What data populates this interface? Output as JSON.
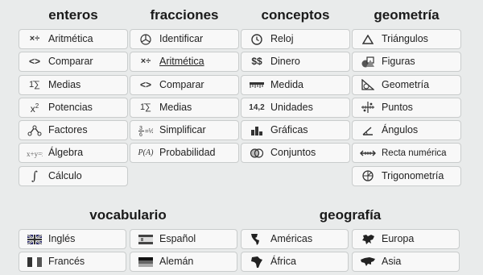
{
  "columns": [
    {
      "heading": "enteros",
      "items": [
        {
          "label": "Aritmética",
          "icon": "arithmetic-icon",
          "glyph": "×÷"
        },
        {
          "label": "Comparar",
          "icon": "compare-icon",
          "glyph": "<>"
        },
        {
          "label": "Medias",
          "icon": "mean-icon",
          "glyph": "1̄∑"
        },
        {
          "label": "Potencias",
          "icon": "power-icon",
          "glyph": "x²"
        },
        {
          "label": "Factores",
          "icon": "factor-tree-icon",
          "glyph": ""
        },
        {
          "label": "Álgebra",
          "icon": "algebra-icon",
          "glyph": ""
        },
        {
          "label": "Cálculo",
          "icon": "integral-icon",
          "glyph": "∫"
        }
      ]
    },
    {
      "heading": "fracciones",
      "items": [
        {
          "label": "Identificar",
          "icon": "pie-fraction-icon",
          "glyph": ""
        },
        {
          "label": "Aritmética",
          "icon": "arithmetic-icon",
          "glyph": "×÷"
        },
        {
          "label": "Comparar",
          "icon": "compare-icon",
          "glyph": "<>"
        },
        {
          "label": "Medias",
          "icon": "mean-icon",
          "glyph": "1̄∑"
        },
        {
          "label": "Simplificar",
          "icon": "simplify-fraction-icon",
          "glyph": ""
        },
        {
          "label": "Probabilidad",
          "icon": "probability-icon",
          "glyph": "P(A)"
        }
      ]
    },
    {
      "heading": "conceptos",
      "items": [
        {
          "label": "Reloj",
          "icon": "clock-icon",
          "glyph": ""
        },
        {
          "label": "Dinero",
          "icon": "money-icon",
          "glyph": "$$"
        },
        {
          "label": "Medida",
          "icon": "ruler-icon",
          "glyph": ""
        },
        {
          "label": "Unidades",
          "icon": "units-icon",
          "glyph": "14,2"
        },
        {
          "label": "Gráficas",
          "icon": "bar-chart-icon",
          "glyph": ""
        },
        {
          "label": "Conjuntos",
          "icon": "venn-sets-icon",
          "glyph": ""
        }
      ]
    },
    {
      "heading": "geometría",
      "items": [
        {
          "label": "Triángulos",
          "icon": "triangle-icon",
          "glyph": "△"
        },
        {
          "label": "Figuras",
          "icon": "shapes-icon",
          "glyph": ""
        },
        {
          "label": "Geometría",
          "icon": "geometry-icon",
          "glyph": ""
        },
        {
          "label": "Puntos",
          "icon": "coordinate-points-icon",
          "glyph": ""
        },
        {
          "label": "Ángulos",
          "icon": "angle-icon",
          "glyph": "∠"
        },
        {
          "label": "Recta numérica",
          "icon": "number-line-icon",
          "glyph": "↔"
        },
        {
          "label": "Trigonometría",
          "icon": "trig-circle-icon",
          "glyph": ""
        }
      ]
    }
  ],
  "vocabulario": {
    "heading": "vocabulario",
    "items": [
      {
        "label": "Inglés",
        "icon": "uk-flag-icon"
      },
      {
        "label": "Español",
        "icon": "spain-flag-icon"
      },
      {
        "label": "Francés",
        "icon": "france-flag-icon"
      },
      {
        "label": "Alemán",
        "icon": "germany-flag-icon"
      }
    ]
  },
  "geografia": {
    "heading": "geografía",
    "items": [
      {
        "label": "Américas",
        "icon": "americas-map-icon"
      },
      {
        "label": "Europa",
        "icon": "europe-map-icon"
      },
      {
        "label": "África",
        "icon": "africa-map-icon"
      },
      {
        "label": "Asia",
        "icon": "asia-map-icon"
      }
    ]
  },
  "colors": {
    "background": "#e9ebeb",
    "button": "#f8f8f8",
    "border": "#c9cccc",
    "text": "#222222"
  }
}
